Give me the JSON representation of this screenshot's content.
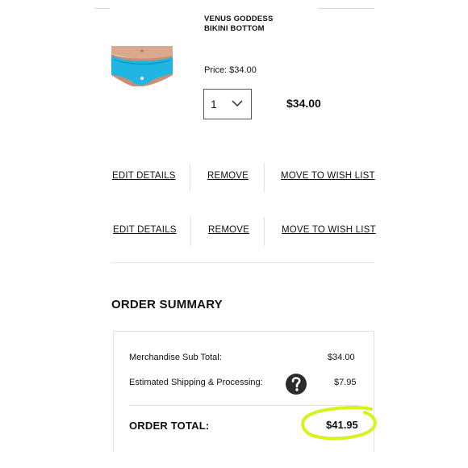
{
  "product": {
    "name": "VENUS GODDESS BIKINI BOTTOM",
    "price": "Price: $34.00",
    "line_total": "$34.00",
    "image_icon": "bikini-bottom-product-photo"
  },
  "quantity": {
    "selected": "1",
    "chevron_icon": "chevron-down-icon"
  },
  "actions": [
    {
      "edit": "EDIT DETAILS",
      "remove": "REMOVE",
      "wishlist": "MOVE TO WISH LIST"
    },
    {
      "edit": "EDIT DETAILS",
      "remove": "REMOVE",
      "wishlist": "MOVE TO WISH LIST"
    }
  ],
  "summary": {
    "title": "ORDER SUMMARY",
    "subtotal_label": "Merchandise Sub Total:",
    "subtotal_value": "$34.00",
    "shipping_label": "Estimated Shipping & Processing:",
    "shipping_value": "$7.95",
    "help_icon": "question-circle-icon",
    "order_total_label": "ORDER TOTAL:",
    "order_total_value": "$41.95"
  },
  "colors": {
    "highlight": "#d7f21c",
    "help_icon_bg": "#2b2b2b"
  }
}
